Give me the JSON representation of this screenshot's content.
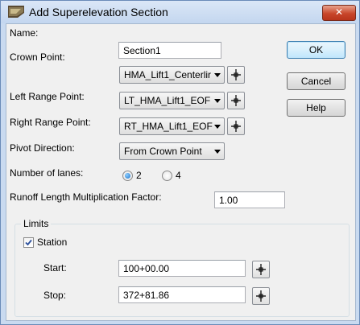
{
  "window": {
    "title": "Add Superelevation Section",
    "close_label": "✕",
    "app_icon": "superelevation-app-icon"
  },
  "form": {
    "name_label": "Name:",
    "name_value": "Section1",
    "crown_point_label": "Crown Point:",
    "crown_point_value": "HMA_Lift1_Centerlir",
    "left_range_label": "Left Range Point:",
    "left_range_value": "LT_HMA_Lift1_EOF",
    "right_range_label": "Right Range Point:",
    "right_range_value": "RT_HMA_Lift1_EOF",
    "pivot_label": "Pivot Direction:",
    "pivot_value": "From Crown Point",
    "lanes_label": "Number of lanes:",
    "lanes_options": [
      "2",
      "4"
    ],
    "lanes_selected": "2",
    "runoff_label": "Runoff Length Multiplication Factor:",
    "runoff_value": "1.00"
  },
  "buttons": {
    "ok": "OK",
    "cancel": "Cancel",
    "help": "Help"
  },
  "limits": {
    "group_title": "Limits",
    "station_label": "Station",
    "station_checked": true,
    "start_label": "Start:",
    "start_value": "100+00.00",
    "stop_label": "Stop:",
    "stop_value": "372+81.86"
  },
  "icons": {
    "pick": "crosshair-pick-icon",
    "dropdown": "dropdown-arrow-icon",
    "checkmark": "checkmark-icon"
  },
  "colors": {
    "title_bar": "#c9daf0",
    "close_button": "#c8462a",
    "default_button_border": "#3c7fb1",
    "radio_selected": "#1e72c9",
    "dialog_background": "#f0f0f0"
  }
}
